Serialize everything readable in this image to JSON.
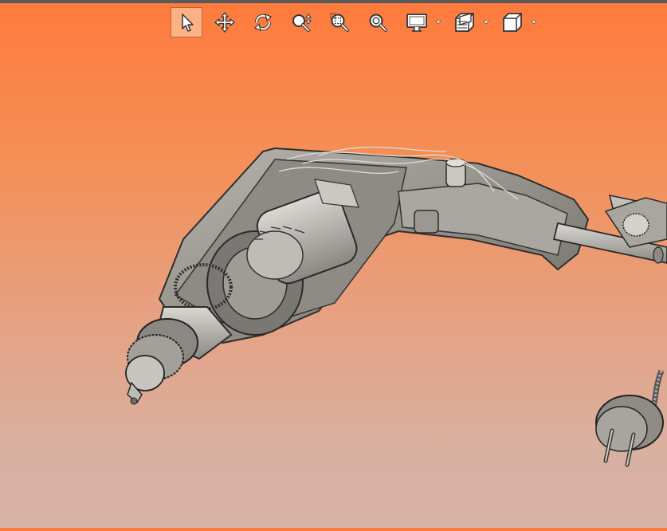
{
  "toolbar": {
    "tools": [
      {
        "id": "select",
        "icon": "pointer-arrow-icon",
        "active": true
      },
      {
        "id": "pan",
        "icon": "move-arrows-icon",
        "active": false
      },
      {
        "id": "rotate",
        "icon": "rotate-icon",
        "active": false
      },
      {
        "id": "zoom",
        "icon": "zoom-updown-icon",
        "active": false
      },
      {
        "id": "zoom-window",
        "icon": "zoom-window-icon",
        "active": false
      },
      {
        "id": "zoom-fit",
        "icon": "zoom-fit-icon",
        "active": false
      }
    ],
    "dropdowns": [
      {
        "id": "display",
        "icon": "monitor-icon"
      },
      {
        "id": "section-view",
        "icon": "section-cube-icon"
      },
      {
        "id": "view-orientation",
        "icon": "cube-outline-icon"
      }
    ]
  },
  "colors": {
    "background_top": "#ff7a3c",
    "background_bottom": "#d6b2a6",
    "model_gray": "#9c9a92",
    "model_dark": "#3a3a38"
  }
}
